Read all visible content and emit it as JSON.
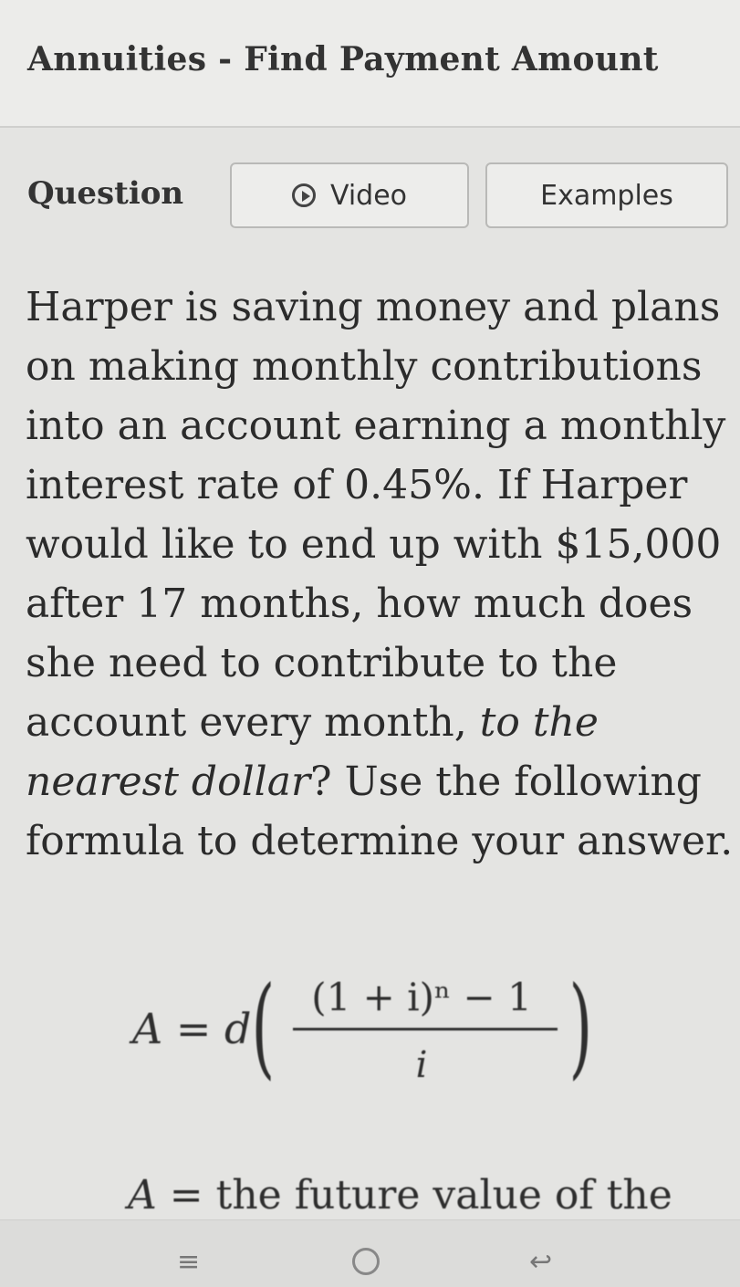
{
  "header": {
    "title": "Annuities - Find Payment Amount"
  },
  "tabs": {
    "question_label": "Question",
    "video_label": "Video",
    "examples_label": "Examples"
  },
  "question": {
    "text_before": "Harper is saving money and plans on making monthly contributions into an account earning a monthly interest rate of 0.45%. If Harper would like to end up with $15,000 after 17 months, how much does she need to contribute to the account every month, ",
    "text_italic": "to the nearest dollar",
    "text_after": "? Use the following formula to determine your answer."
  },
  "formula": {
    "lhs": "A = d",
    "numerator": "(1 + i)ⁿ − 1",
    "denominator": "i"
  },
  "definition": {
    "variable": "A",
    "equals": "=",
    "text": "the future value of the"
  },
  "navbar": {
    "menu_icon": "≡",
    "back_icon": "↩"
  }
}
